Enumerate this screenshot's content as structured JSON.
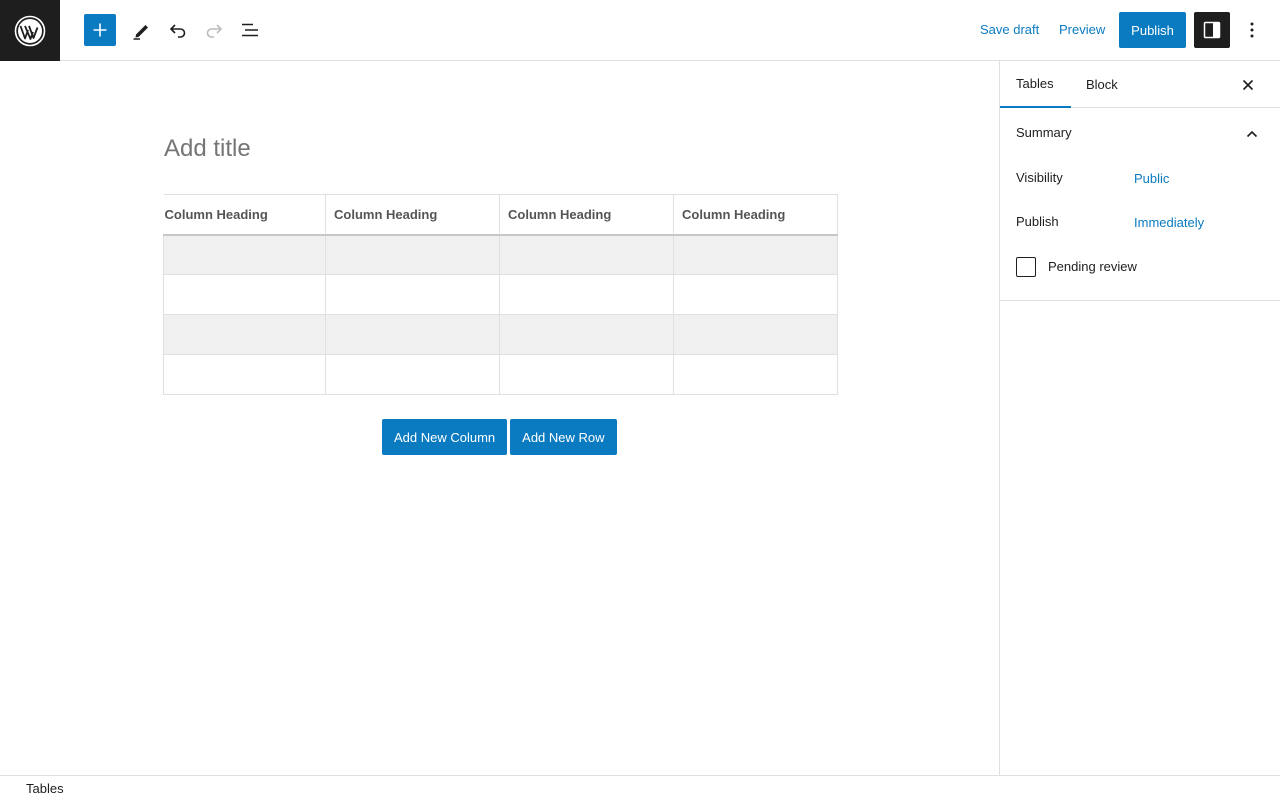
{
  "toolbar": {
    "save_draft": "Save draft",
    "preview": "Preview",
    "publish": "Publish",
    "icons": [
      "wordpress-logo",
      "plus-icon",
      "pencil-icon",
      "undo-icon",
      "redo-icon",
      "list-view-icon",
      "sidebar-toggle-icon",
      "more-options-icon"
    ],
    "accent_color": "#0a7bc1"
  },
  "editor": {
    "title_placeholder": "Add title",
    "table": {
      "headers": [
        "Column Heading",
        "Column Heading",
        "Column Heading",
        "Column Heading"
      ],
      "rows": [
        [
          "",
          "",
          "",
          ""
        ],
        [
          "",
          "",
          "",
          ""
        ],
        [
          "",
          "",
          "",
          ""
        ],
        [
          "",
          "",
          "",
          ""
        ]
      ]
    },
    "add_column": "Add New Column",
    "add_row": "Add New Row"
  },
  "sidebar": {
    "tabs": [
      "Tables",
      "Block"
    ],
    "active_tab": "Tables",
    "panel": {
      "title": "Summary",
      "visibility_label": "Visibility",
      "visibility_value": "Public",
      "publish_label": "Publish",
      "publish_value": "Immediately",
      "pending_review": "Pending review",
      "pending_checked": false
    }
  },
  "footer": {
    "breadcrumb": "Tables"
  }
}
